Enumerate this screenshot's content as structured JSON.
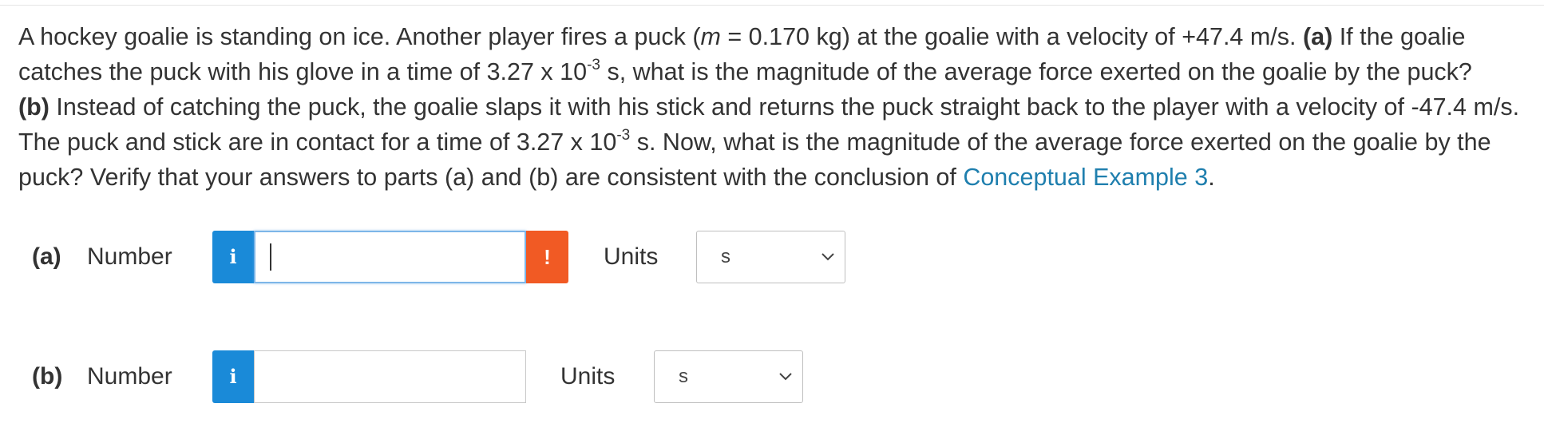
{
  "question": {
    "intro": "A hockey goalie is standing on ice. Another player fires a puck (",
    "mass_var": "m",
    "mass_text": " = 0.170 kg) at the goalie with a velocity of +47.4 m/s. ",
    "part_a_tag": "(a)",
    "part_a_text_1": " If the goalie catches the puck with his glove in a time of 3.27 x 10",
    "part_a_exp": "-3",
    "part_a_text_2": " s, what is the magnitude of the average force exerted on the goalie by the puck? ",
    "part_b_tag": "(b)",
    "part_b_text_1": " Instead of catching the puck, the goalie slaps it with his stick and returns the puck straight back to the player with a velocity of -47.4 m/s. The puck and stick are in contact for a time of 3.27 x 10",
    "part_b_exp": "-3",
    "part_b_text_2": " s. Now, what is the magnitude of the average force exerted on the goalie by the puck? Verify that your answers to parts (a) and (b) are consistent with the conclusion of ",
    "link_text": "Conceptual Example 3",
    "end_text": "."
  },
  "parts": [
    {
      "label": "(a)",
      "number_label": "Number",
      "info_icon": "i",
      "input_value": "",
      "warning_icon": "!",
      "units_label": "Units",
      "units_selected": "s"
    },
    {
      "label": "(b)",
      "number_label": "Number",
      "info_icon": "i",
      "input_value": "",
      "units_label": "Units",
      "units_selected": "s"
    }
  ],
  "colors": {
    "info_blue": "#1a8ad8",
    "warning_orange": "#f15a24",
    "link_blue": "#1f7fae",
    "text": "#333333"
  }
}
